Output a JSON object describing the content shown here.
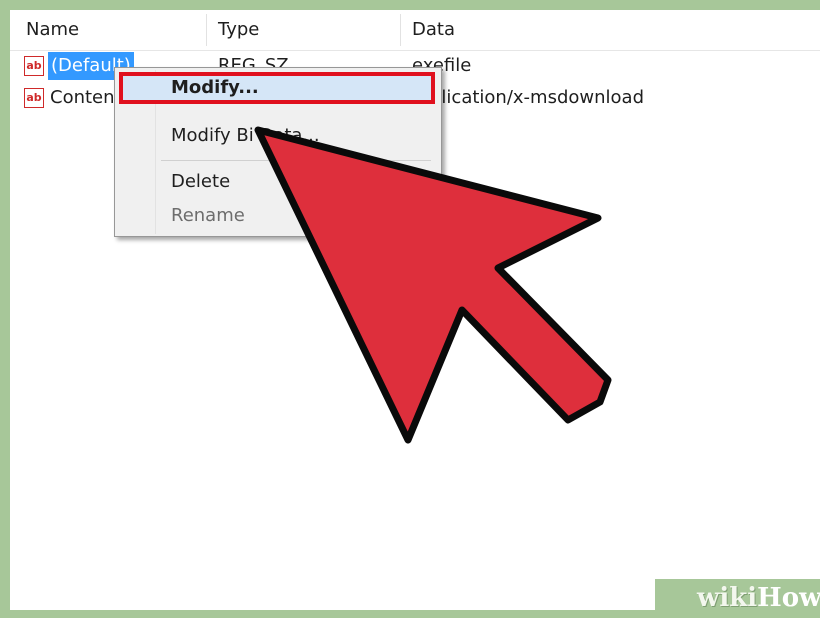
{
  "columns": [
    "Name",
    "Type",
    "Data"
  ],
  "rows": [
    {
      "name": "(Default)",
      "type": "REG_SZ",
      "data": "exefile",
      "icon": "string-value-icon"
    },
    {
      "name": "Conten",
      "type": "",
      "data": "plication/x-msdownload",
      "icon": "string-value-icon"
    }
  ],
  "context_menu": {
    "items": [
      {
        "label": "Modify...",
        "highlighted": true
      },
      {
        "label": "Modify Bi  Data..."
      },
      {
        "label": "Delete"
      },
      {
        "label": "Rename",
        "disabled": true
      }
    ]
  },
  "watermark": {
    "part1": "wiki",
    "part2": "How"
  },
  "colors": {
    "background": "#a7c799",
    "selection": "#3399ff",
    "highlight_border": "#e0101e",
    "arrow": "#de2f3c"
  },
  "icons": {
    "row_icon": "ab-string-icon",
    "pointer": "large-red-arrow-cursor"
  }
}
